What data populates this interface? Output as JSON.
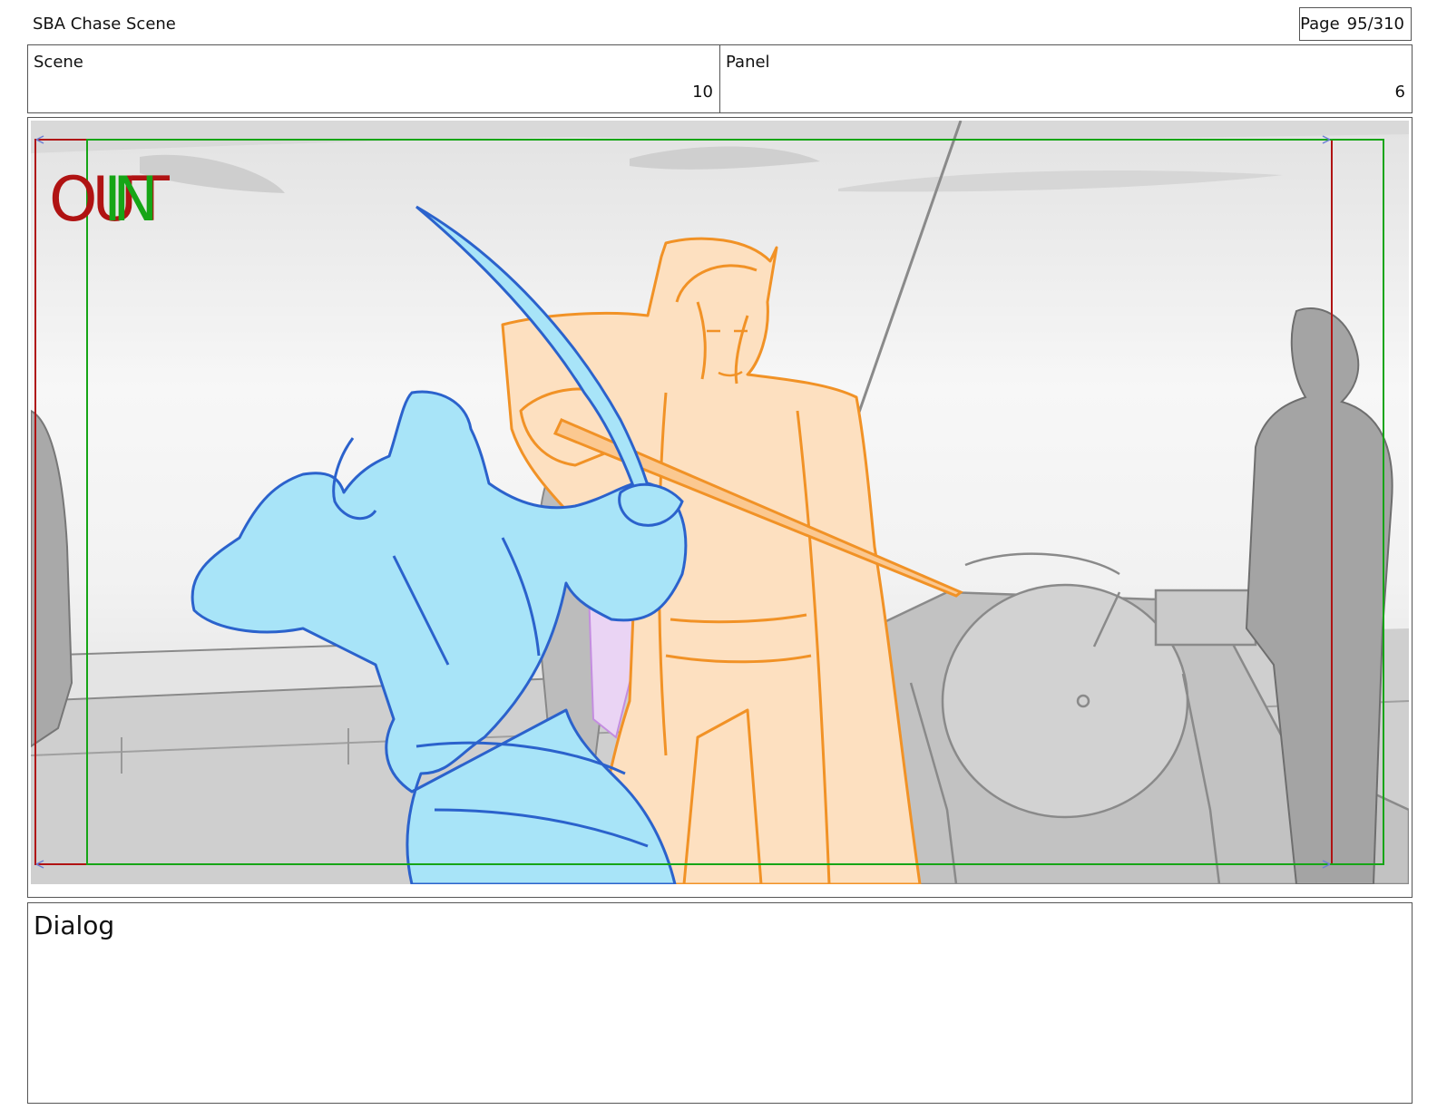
{
  "header": {
    "title": "SBA Chase Scene",
    "page_label": "Page",
    "page_value": "95/310"
  },
  "info": {
    "scene_label": "Scene",
    "scene_value": "10",
    "panel_label": "Panel",
    "panel_value": "6"
  },
  "frame": {
    "out_marker": "OUT",
    "in_marker": "IN",
    "out_color": "#b01313",
    "in_color": "#16a516",
    "figure_front_color": "#a8e4f8",
    "figure_front_line": "#2b62cc",
    "figure_back_color": "#fde0c0",
    "figure_back_line": "#f19226",
    "background_line": "#8a8a8a"
  },
  "dialog": {
    "label": "Dialog"
  }
}
